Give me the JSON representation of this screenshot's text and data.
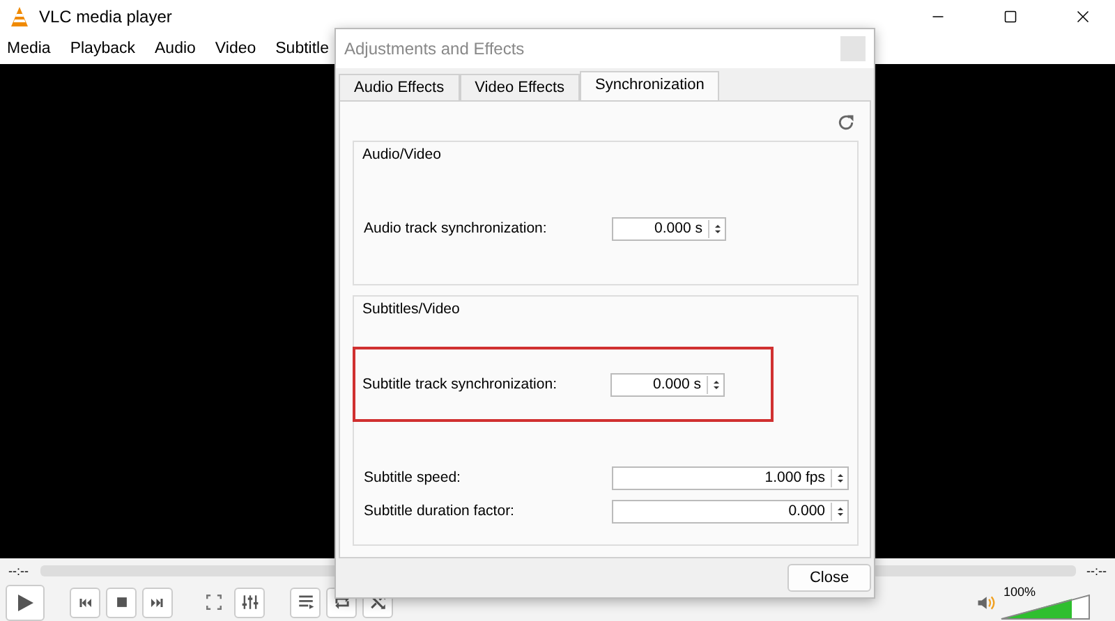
{
  "window": {
    "title": "VLC media player"
  },
  "menu": [
    "Media",
    "Playback",
    "Audio",
    "Video",
    "Subtitle"
  ],
  "dialog": {
    "title": "Adjustments and Effects",
    "tabs": [
      {
        "label": "Audio Effects",
        "selected": false
      },
      {
        "label": "Video Effects",
        "selected": false
      },
      {
        "label": "Synchronization",
        "selected": true
      }
    ],
    "groups": [
      {
        "title": "Audio/Video",
        "rows": [
          {
            "label": "Audio track synchronization:",
            "value": "0.000 s",
            "wide": false,
            "highlighted": false
          }
        ]
      },
      {
        "title": "Subtitles/Video",
        "rows": [
          {
            "label": "Subtitle track synchronization:",
            "value": "0.000 s",
            "wide": false,
            "highlighted": true
          },
          {
            "label": "Subtitle speed:",
            "value": "1.000 fps",
            "wide": true,
            "highlighted": false
          },
          {
            "label": "Subtitle duration factor:",
            "value": "0.000",
            "wide": true,
            "highlighted": false
          }
        ]
      }
    ],
    "close_button": "Close"
  },
  "player": {
    "elapsed": "--:--",
    "total": "--:--",
    "volume": {
      "reading": "100%",
      "level": 0.8
    }
  }
}
